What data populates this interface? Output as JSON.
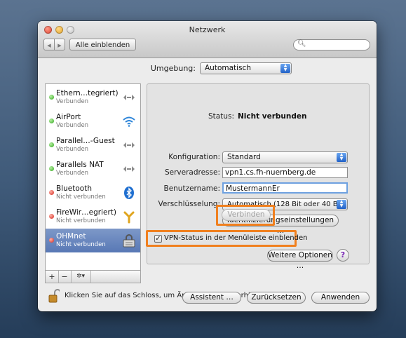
{
  "window": {
    "title": "Netzwerk",
    "show_all": "Alle einblenden",
    "search_placeholder": ""
  },
  "environment": {
    "label": "Umgebung:",
    "value": "Automatisch"
  },
  "services": [
    {
      "name": "Ethern…tegriert)",
      "status": "Verbunden",
      "state": "green",
      "icon": "ethernet-icon"
    },
    {
      "name": "AirPort",
      "status": "Verbunden",
      "state": "green",
      "icon": "wifi-icon"
    },
    {
      "name": "Parallel…-Guest",
      "status": "Verbunden",
      "state": "green",
      "icon": "ethernet-icon"
    },
    {
      "name": "Parallels NAT",
      "status": "Verbunden",
      "state": "green",
      "icon": "ethernet-icon"
    },
    {
      "name": "Bluetooth",
      "status": "Nicht verbunden",
      "state": "red",
      "icon": "bluetooth-icon"
    },
    {
      "name": "FireWir…egriert)",
      "status": "Nicht verbunden",
      "state": "red",
      "icon": "firewire-icon"
    },
    {
      "name": "OHMnet",
      "status": "Nicht verbunden",
      "state": "red",
      "icon": "vpn-lock-icon",
      "selected": true
    }
  ],
  "sidebar_buttons": {
    "add": "+",
    "remove": "−",
    "gear": "✲▾"
  },
  "detail": {
    "status_label": "Status:",
    "status_value": "Nicht verbunden",
    "config_label": "Konfiguration:",
    "config_value": "Standard",
    "server_label": "Serveradresse:",
    "server_value": "vpn1.cs.fh-nuernberg.de",
    "user_label": "Benutzername:",
    "user_value": "MustermannEr",
    "encryption_label": "Verschlüsselung:",
    "encryption_value": "Automatisch (128 Bit oder 40 Bit)",
    "auth_button": "Identifizierungseinstellungen …",
    "connect_button": "Verbinden",
    "vpn_status_checkbox": "VPN-Status in der Menüleiste einblenden",
    "vpn_status_checked": true,
    "more_options": "Weitere Optionen …",
    "help": "?"
  },
  "footer": {
    "lock_text": "Klicken Sie auf das Schloss, um Änderungen zu verhindern.",
    "assistant": "Assistent …",
    "revert": "Zurücksetzen",
    "apply": "Anwenden"
  },
  "colors": {
    "highlight": "#f0801f",
    "selection": "#5878b5",
    "desktop": "#3f5a79"
  }
}
